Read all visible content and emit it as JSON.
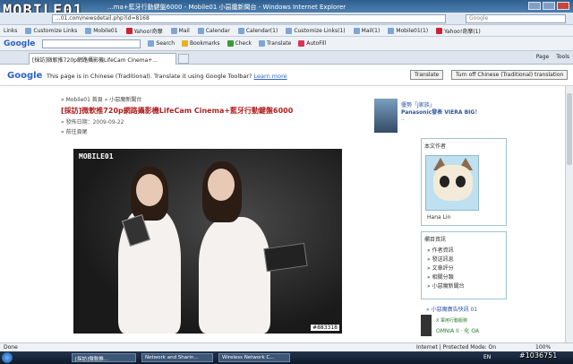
{
  "watermark": {
    "logo": "MOBILE01",
    "serial": "#1036751"
  },
  "window": {
    "title": "...ma+藍牙行動鍵盤6000 - Mobile01 小惡魔新聞台 - Windows Internet Explorer"
  },
  "address": {
    "url": "...01.com/newsdetail.php?id=8168",
    "search_placeholder": "Google"
  },
  "links_bar": {
    "items": [
      {
        "label": "Links",
        "icon": ""
      },
      {
        "label": "Customize Links",
        "icon": "ie-page-icon"
      },
      {
        "label": "Mobile01",
        "icon": "m01-icon"
      },
      {
        "label": "Yahoo!奇摩",
        "icon": "yahoo-icon"
      },
      {
        "label": "Mail",
        "icon": "mail-icon"
      },
      {
        "label": "Calendar",
        "icon": "calendar-icon"
      },
      {
        "label": "Calendar(1)",
        "icon": "calendar-icon"
      },
      {
        "label": "Customize Links(1)",
        "icon": "ie-page-icon"
      },
      {
        "label": "Mail(1)",
        "icon": "mail-icon"
      },
      {
        "label": "Mobile01(1)",
        "icon": "m01-icon"
      },
      {
        "label": "Yahoo!奇摩(1)",
        "icon": "yahoo-icon"
      }
    ]
  },
  "google_toolbar": {
    "logo": "Google",
    "buttons": [
      {
        "label": "Search"
      },
      {
        "label": "Bookmarks"
      },
      {
        "label": "Check"
      },
      {
        "label": "Translate"
      },
      {
        "label": "AutoFill"
      }
    ]
  },
  "tabs": {
    "active": "[採訪]微軟推720p網路攝影機LifeCam Cinema+...",
    "tools": [
      "Page",
      "Tools"
    ]
  },
  "translate_bar": {
    "logo": "Google",
    "message": "This page is in Chinese (Traditional).  Translate it using Google Toolbar?",
    "learn_more": "Learn more",
    "translate_button": "Translate",
    "turn_off_button": "Turn off Chinese (Traditional) translation"
  },
  "article": {
    "breadcrumb": "» Mobile01 首頁 » 小惡魔新聞台",
    "title": "[採訪]微軟推720p網路攝影機LifeCam Cinema+藍牙行動鍵盤6000",
    "date": "» 發佈日期：2009-09-22",
    "prev": "» 前往頁尾",
    "photo_watermark": "MOBILE01",
    "photo_id": "#883318"
  },
  "ad": {
    "line1": "優勢「J家族」",
    "line2": "Panasonic發表 VIERA BIG！",
    "line3": "..."
  },
  "sidebar": {
    "author_header": "本文作者",
    "author_name": "Hana Lin",
    "nav_header": "欄目資訊",
    "nav_items": [
      "» 作者資訊",
      "» 發送訊息",
      "» 文章評分",
      "» 相關分類",
      "» 小惡魔新聞台"
    ],
    "promo_header": "» 小惡魔廣告快訊 01",
    "promo_line1": "X 軍用行動服務",
    "promo_line2": "OMNIA II · 化 OA"
  },
  "statusbar": {
    "left": "Done",
    "zone": "Internet | Protected Mode: On",
    "zoom": "100%"
  },
  "taskbar": {
    "items": [
      "[採訪]微軟推...",
      "Network and Sharin...",
      "Wireless Network C..."
    ],
    "tray": "EN"
  }
}
